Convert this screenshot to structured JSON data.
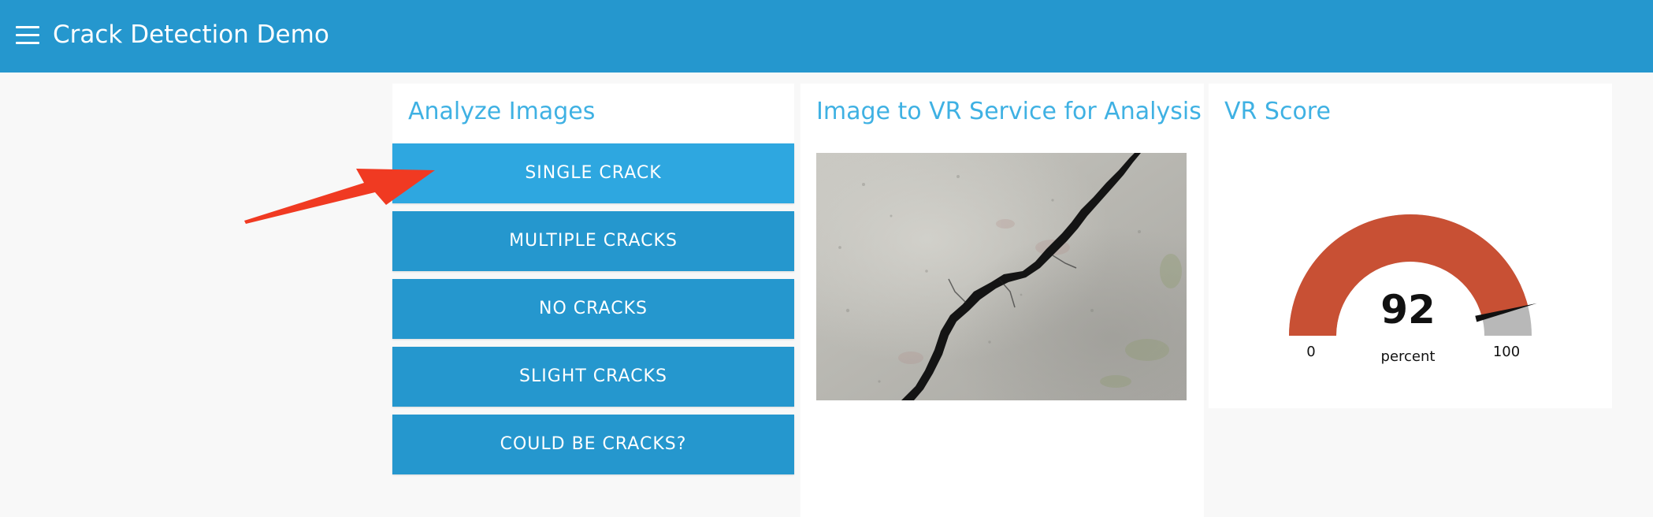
{
  "header": {
    "title": "Crack Detection Demo",
    "menu_icon": "hamburger-menu-icon",
    "color": "#2597ce"
  },
  "analyze": {
    "title": "Analyze Images",
    "buttons": [
      {
        "label": "SINGLE CRACK"
      },
      {
        "label": "MULTIPLE CRACKS"
      },
      {
        "label": "NO CRACKS"
      },
      {
        "label": "SLIGHT CRACKS"
      },
      {
        "label": "COULD BE CRACKS?"
      }
    ]
  },
  "image_panel": {
    "title": "Image to VR Service for Analysis"
  },
  "score_panel": {
    "title": "VR Score",
    "gauge": {
      "value": 92,
      "min": 0,
      "max": 100,
      "min_label": "0",
      "max_label": "100",
      "value_label": "92",
      "units": "percent",
      "fill_color": "#c85034",
      "track_color": "#b8b8b8"
    }
  },
  "annotation": {
    "arrow_color": "#f03a22",
    "arrow_icon": "pointer-arrow-icon"
  }
}
